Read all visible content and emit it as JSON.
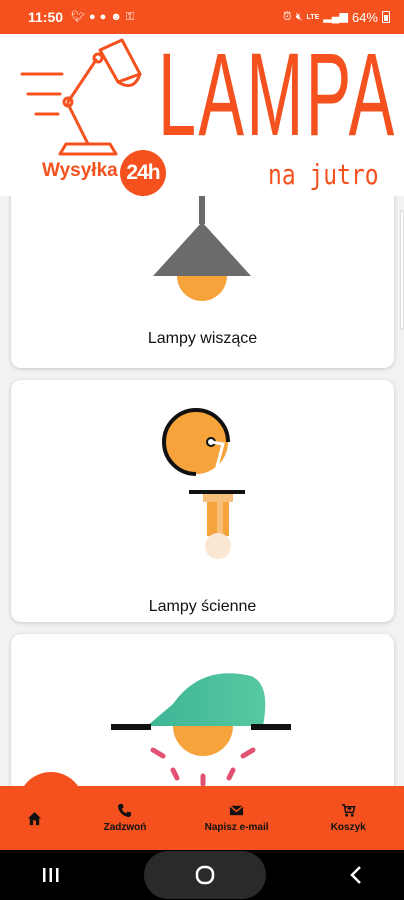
{
  "status_bar": {
    "time": "11:50",
    "battery": "64%",
    "left_icons": [
      "twitter-icon",
      "messenger-icon",
      "messenger-icon",
      "face-icon",
      "key-icon"
    ],
    "right_icons": [
      "alarm-icon",
      "mute-icon",
      "lte-icon",
      "signal-icon",
      "battery-icon"
    ],
    "lte_label": "LTE"
  },
  "header": {
    "brand": "LAMPA",
    "tagline": "na jutro",
    "shipping": "Wysyłka",
    "badge": "24h",
    "accent": "#f4511e"
  },
  "categories": [
    {
      "label": "Lampy wiszące",
      "icon": "pendant-lamp-icon"
    },
    {
      "label": "Lampy ścienne",
      "icon": "wall-lamp-icon"
    },
    {
      "label": "",
      "icon": "ceiling-lamp-icon"
    }
  ],
  "bottom_nav": {
    "home": {
      "icon": "home-icon",
      "label": ""
    },
    "call": {
      "icon": "phone-icon",
      "label": "Zadzwoń"
    },
    "email": {
      "icon": "mail-icon",
      "label": "Napisz e-mail"
    },
    "cart": {
      "icon": "cart-icon",
      "label": "Koszyk"
    }
  },
  "system_nav": [
    "recents-icon",
    "home-button-icon",
    "back-icon"
  ],
  "colors": {
    "accent": "#f4511e",
    "lamp_orange": "#f5a33a",
    "lamp_grey": "#6b6b6b",
    "lamp_teal": "#3fb596"
  }
}
